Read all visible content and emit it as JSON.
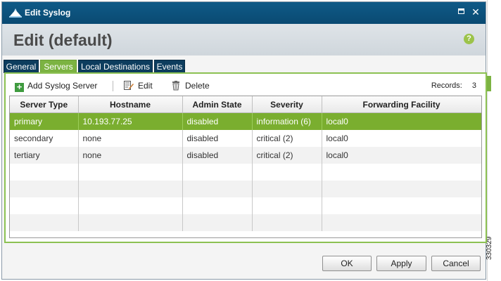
{
  "window": {
    "title": "Edit Syslog"
  },
  "header": {
    "title": "Edit (default)",
    "help_glyph": "?"
  },
  "tabs": [
    {
      "label": "General",
      "active": false
    },
    {
      "label": "Servers",
      "active": true
    },
    {
      "label": "Local Destinations",
      "active": false
    },
    {
      "label": "Events",
      "active": false
    }
  ],
  "toolbar": {
    "add_label": "Add Syslog Server",
    "edit_label": "Edit",
    "delete_label": "Delete",
    "records_label": "Records:",
    "records_count": "3"
  },
  "table": {
    "columns": [
      "Server Type",
      "Hostname",
      "Admin State",
      "Severity",
      "Forwarding Facility"
    ],
    "rows": [
      [
        "primary",
        "10.193.77.25",
        "disabled",
        "information (6)",
        "local0"
      ],
      [
        "secondary",
        "none",
        "disabled",
        "critical (2)",
        "local0"
      ],
      [
        "tertiary",
        "none",
        "disabled",
        "critical (2)",
        "local0"
      ]
    ],
    "selected_row": 0
  },
  "buttons": {
    "ok": "OK",
    "apply": "Apply",
    "cancel": "Cancel"
  },
  "figure_id": "330329",
  "colors": {
    "titlebar": "#0a4a72",
    "accent_green": "#7cb342",
    "tab_dark": "#0d3d5e"
  },
  "icons": {
    "title": "app-icon",
    "maximize": "maximize-icon",
    "close": "close-icon",
    "help": "help-icon",
    "add": "add-icon",
    "edit": "edit-icon",
    "delete": "trash-icon"
  }
}
